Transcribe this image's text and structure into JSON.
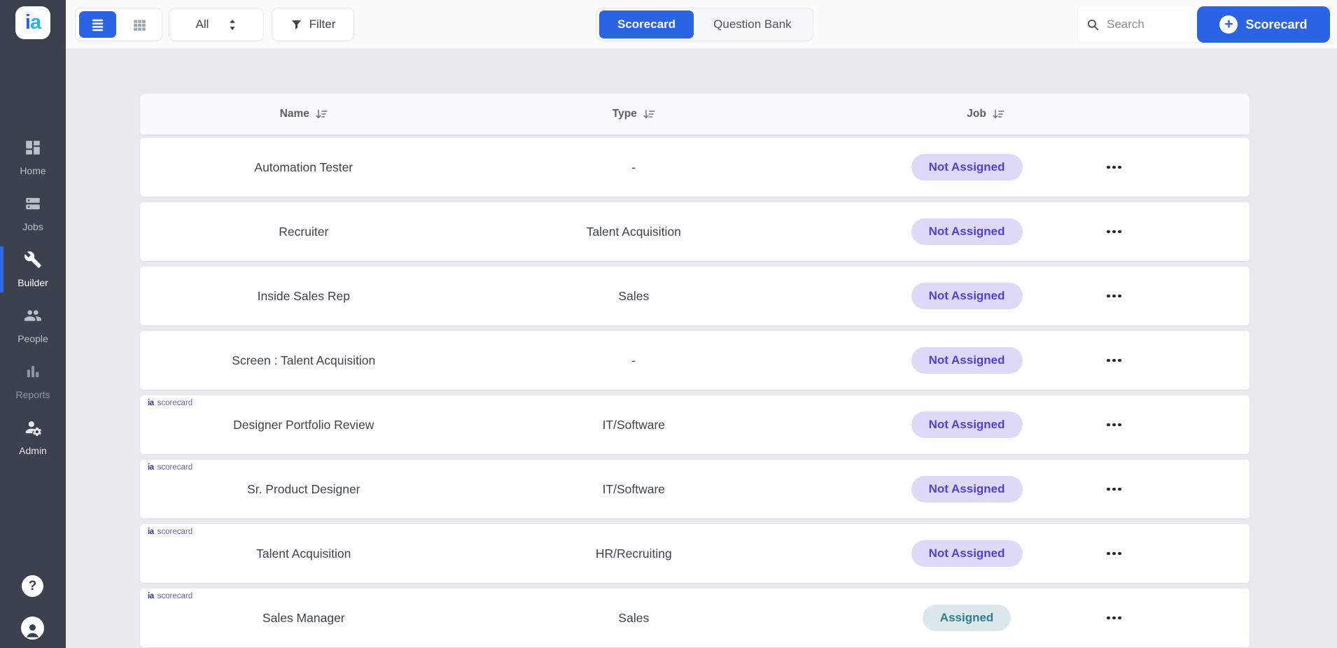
{
  "app": {
    "logo_i": "i",
    "logo_a": "a",
    "logo_icon": "ia-logo"
  },
  "colors": {
    "accent_blue": "#2a63e4",
    "sidebar_bg": "#3b424e",
    "page_bg": "#e9eaee",
    "not_assigned_text": "#5340d9",
    "not_assigned_bg": "#ddd9f6",
    "assigned_text": "#2e7e8e",
    "assigned_bg": "#dbe7ea",
    "scorecard_badge_text": "#6462d2"
  },
  "sidebar": {
    "items": [
      {
        "label": "Home",
        "icon": "home-dashboard-icon",
        "active": false
      },
      {
        "label": "Jobs",
        "icon": "jobs-icon",
        "active": false
      },
      {
        "label": "Builder",
        "icon": "wrench-icon",
        "active": true
      },
      {
        "label": "People",
        "icon": "people-icon",
        "active": false
      },
      {
        "label": "Reports",
        "icon": "bar-chart-icon",
        "active": false
      },
      {
        "label": "Admin",
        "icon": "admin-gear-icon",
        "active": false
      }
    ],
    "help_glyph": "?",
    "help_icon": "help-icon",
    "account_icon": "account-icon"
  },
  "topbar": {
    "view_toggle": [
      {
        "icon": "list-view-icon",
        "active": true
      },
      {
        "icon": "grid-view-icon",
        "active": false
      }
    ],
    "type_filter": {
      "value": "All",
      "icon": "unfold-arrows-icon"
    },
    "filter_label": "Filter",
    "filter_icon": "filter-funnel-icon",
    "tabs": [
      {
        "label": "Scorecard",
        "active": true
      },
      {
        "label": "Question Bank",
        "active": false
      }
    ],
    "search_placeholder": "Search",
    "search_icon": "search-icon",
    "new_button_label": "Scorecard",
    "new_button_icon": "plus-icon",
    "new_button_plus": "+"
  },
  "table": {
    "columns": [
      "Name",
      "Type",
      "Job"
    ],
    "sort_icon": "sort-descending-icon",
    "menu_icon": "ellipsis-icon",
    "badge_logo": "ia",
    "badge_label": "scorecard",
    "rows": [
      {
        "name": "Automation Tester",
        "type": "-",
        "job": "Not Assigned",
        "job_status": "not_assigned",
        "scorecard_badge": false
      },
      {
        "name": "Recruiter",
        "type": "Talent Acquisition",
        "job": "Not Assigned",
        "job_status": "not_assigned",
        "scorecard_badge": false
      },
      {
        "name": "Inside Sales Rep",
        "type": "Sales",
        "job": "Not Assigned",
        "job_status": "not_assigned",
        "scorecard_badge": false
      },
      {
        "name": "Screen : Talent Acquisition",
        "type": "-",
        "job": "Not Assigned",
        "job_status": "not_assigned",
        "scorecard_badge": false
      },
      {
        "name": "Designer Portfolio Review",
        "type": "IT/Software",
        "job": "Not Assigned",
        "job_status": "not_assigned",
        "scorecard_badge": true
      },
      {
        "name": "Sr. Product Designer",
        "type": "IT/Software",
        "job": "Not Assigned",
        "job_status": "not_assigned",
        "scorecard_badge": true
      },
      {
        "name": "Talent Acquisition",
        "type": "HR/Recruiting",
        "job": "Not Assigned",
        "job_status": "not_assigned",
        "scorecard_badge": true
      },
      {
        "name": "Sales Manager",
        "type": "Sales",
        "job": "Assigned",
        "job_status": "assigned",
        "scorecard_badge": true
      }
    ]
  }
}
